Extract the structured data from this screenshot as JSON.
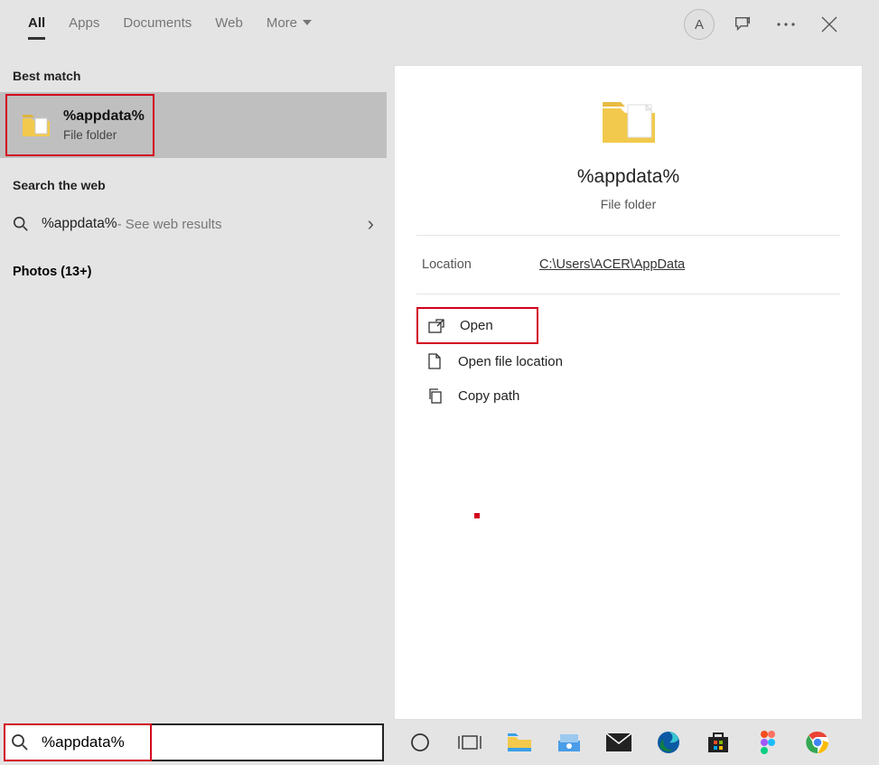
{
  "tabs": {
    "all": "All",
    "apps": "Apps",
    "documents": "Documents",
    "web": "Web",
    "more": "More"
  },
  "avatar_letter": "A",
  "left": {
    "best_match_header": "Best match",
    "best_title": "%appdata%",
    "best_sub": "File folder",
    "web_header": "Search the web",
    "web_main": "%appdata%",
    "web_sub": " - See web results",
    "photos": "Photos (13+)"
  },
  "detail": {
    "title": "%appdata%",
    "subtitle": "File folder",
    "location_label": "Location",
    "location_path": "C:\\Users\\ACER\\AppData",
    "open": "Open",
    "open_loc": "Open file location",
    "copy_path": "Copy path"
  },
  "search_value": "%appdata%"
}
